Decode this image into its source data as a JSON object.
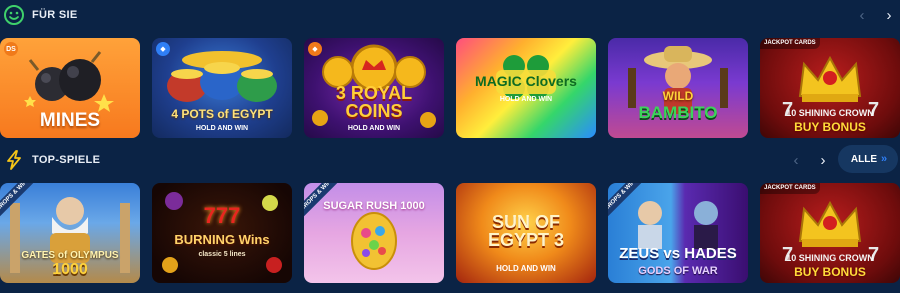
{
  "sections": [
    {
      "title": "FÜR SIE",
      "icon": "smiley-icon",
      "prev_label": "‹",
      "next_label": "›",
      "tiles": [
        {
          "title": "MINES",
          "badge": "DS",
          "badge_color": "#f07a1a"
        },
        {
          "title_line1": "4 POTS of EGYPT",
          "title_line2": "HOLD AND WIN",
          "badge": "◆",
          "badge_color": "#2f7ff5"
        },
        {
          "title_line1": "3 ROYAL COINS",
          "title_line2": "HOLD AND WIN",
          "badge": "◆",
          "badge_color": "#f07a1a"
        },
        {
          "title_line1": "MAGIC Clovers",
          "title_line2": "HOLD AND WIN"
        },
        {
          "title_line1": "WILD",
          "title_line2": "BAMBITO"
        },
        {
          "ribbon": "JACKPOT CARDS",
          "title_line1": "10 SHINING CROWN",
          "title_line2": "BUY BONUS"
        }
      ]
    },
    {
      "title": "TOP-SPIELE",
      "icon": "lightning-icon",
      "prev_label": "‹",
      "next_label": "›",
      "alle_label": "ALLE",
      "alle_chevrons": "»",
      "tiles": [
        {
          "ribbon": "DROPS & WINS",
          "title_line1": "GATES of OLYMPUS",
          "title_line2": "1000"
        },
        {
          "title_line1": "777",
          "title_line2": "BURNING Wins",
          "title_line3": "classic 5 lines"
        },
        {
          "ribbon": "DROPS & WINS",
          "title_line1": "SUGAR RUSH 1000"
        },
        {
          "title_line1": "SUN OF EGYPT 3",
          "title_line2": "HOLD AND WIN"
        },
        {
          "ribbon": "DROPS & WINS",
          "title_line1": "ZEUS vs HADES",
          "title_line2": "GODS OF WAR"
        },
        {
          "ribbon": "JACKPOT CARDS",
          "title_line1": "10 SHINING CROWN",
          "title_line2": "BUY BONUS"
        }
      ]
    }
  ],
  "colors": {
    "background": "#0b2345",
    "accent_green": "#3fd16b",
    "accent_yellow": "#f5c518",
    "alle_button": "#163761",
    "alle_chevron": "#2f7ff5"
  }
}
